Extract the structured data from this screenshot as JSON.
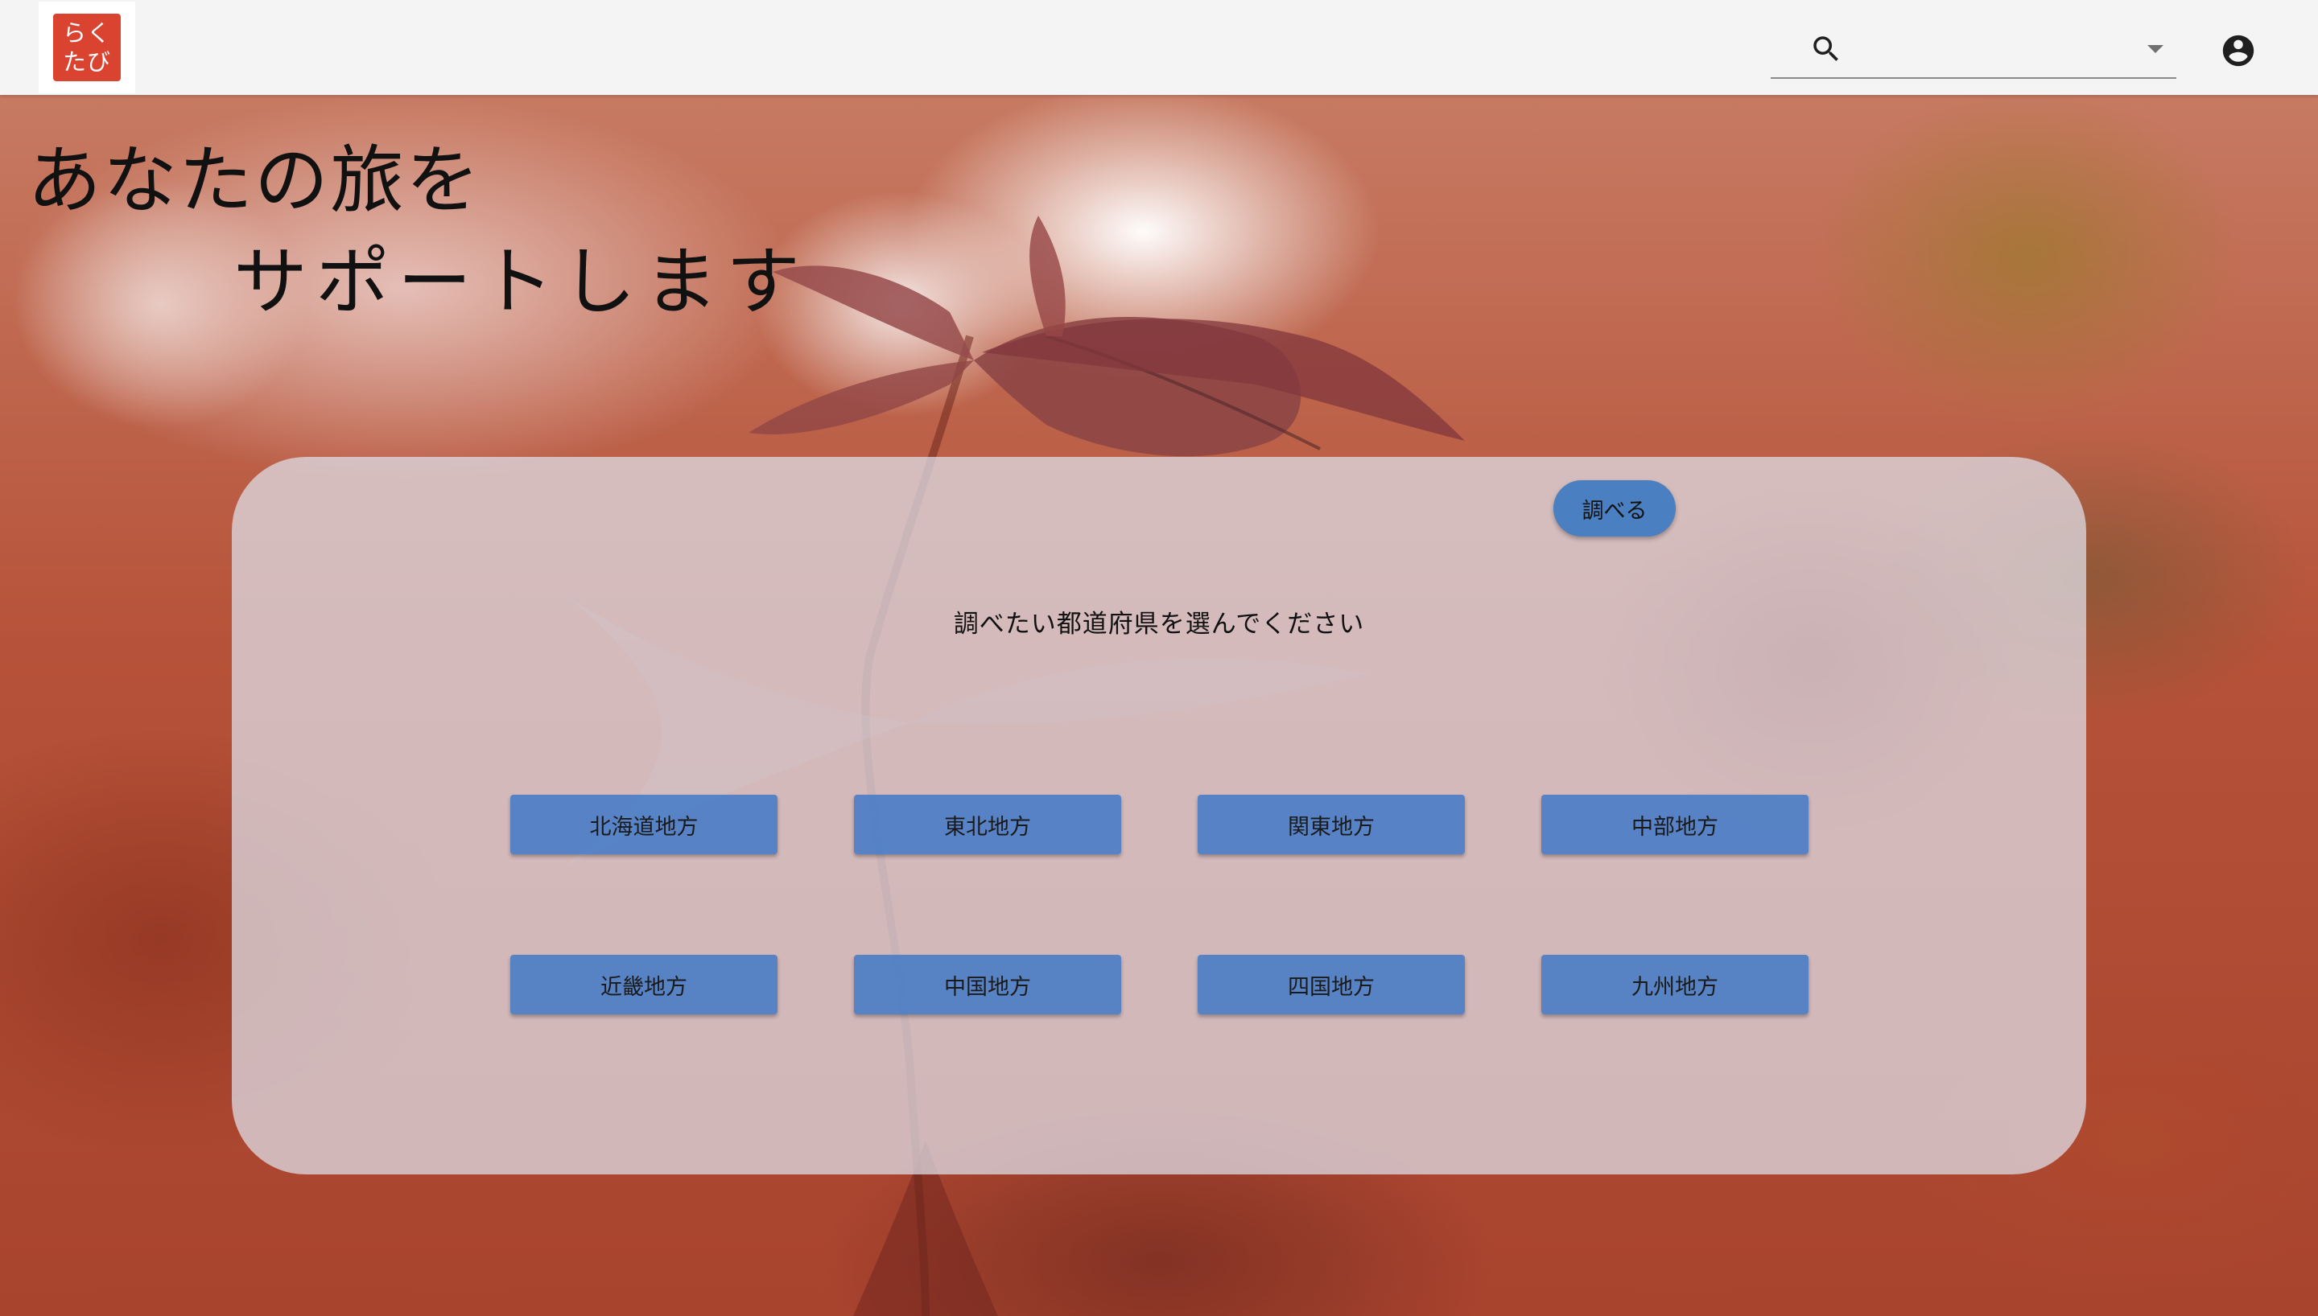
{
  "logo": {
    "line1": "らく",
    "line2": "たび"
  },
  "header": {
    "search": {
      "value": "",
      "placeholder": ""
    }
  },
  "hero": {
    "line1": "あなたの旅を",
    "line2": "サポートします"
  },
  "panel": {
    "search_button": "調べる",
    "instruction": "調べたい都道府県を選んでください",
    "regions": [
      "北海道地方",
      "東北地方",
      "関東地方",
      "中部地方",
      "近畿地方",
      "中国地方",
      "四国地方",
      "九州地方"
    ]
  },
  "colors": {
    "accent": "#4a7fc1",
    "logo": "#d9432f",
    "topbar": "#f4f4f4"
  }
}
